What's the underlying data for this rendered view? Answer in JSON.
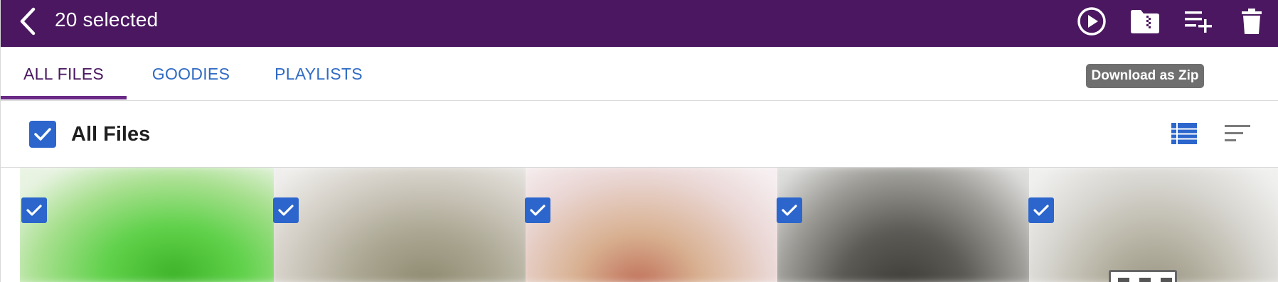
{
  "header": {
    "title": "20 selected",
    "back_icon": "chevron-left-icon",
    "actions": [
      {
        "name": "play",
        "icon": "play-circle-icon"
      },
      {
        "name": "download-zip",
        "icon": "zip-folder-icon"
      },
      {
        "name": "add-to-playlist",
        "icon": "playlist-add-icon"
      },
      {
        "name": "delete",
        "icon": "trash-icon"
      }
    ],
    "background": "#4a1760"
  },
  "tabs": [
    {
      "label": "ALL FILES",
      "active": true
    },
    {
      "label": "GOODIES",
      "active": false
    },
    {
      "label": "PLAYLISTS",
      "active": false
    }
  ],
  "tooltip": {
    "text": "Download as Zip"
  },
  "section": {
    "title": "All Files",
    "checked": true,
    "view_icon": "list-view-icon",
    "sort_icon": "sort-icon"
  },
  "thumbnails": [
    {
      "checked": true
    },
    {
      "checked": true
    },
    {
      "checked": true
    },
    {
      "checked": true
    },
    {
      "checked": true
    }
  ],
  "colors": {
    "accent": "#4a1760",
    "link": "#2f6bc4",
    "checkbox": "#2c66cc"
  }
}
